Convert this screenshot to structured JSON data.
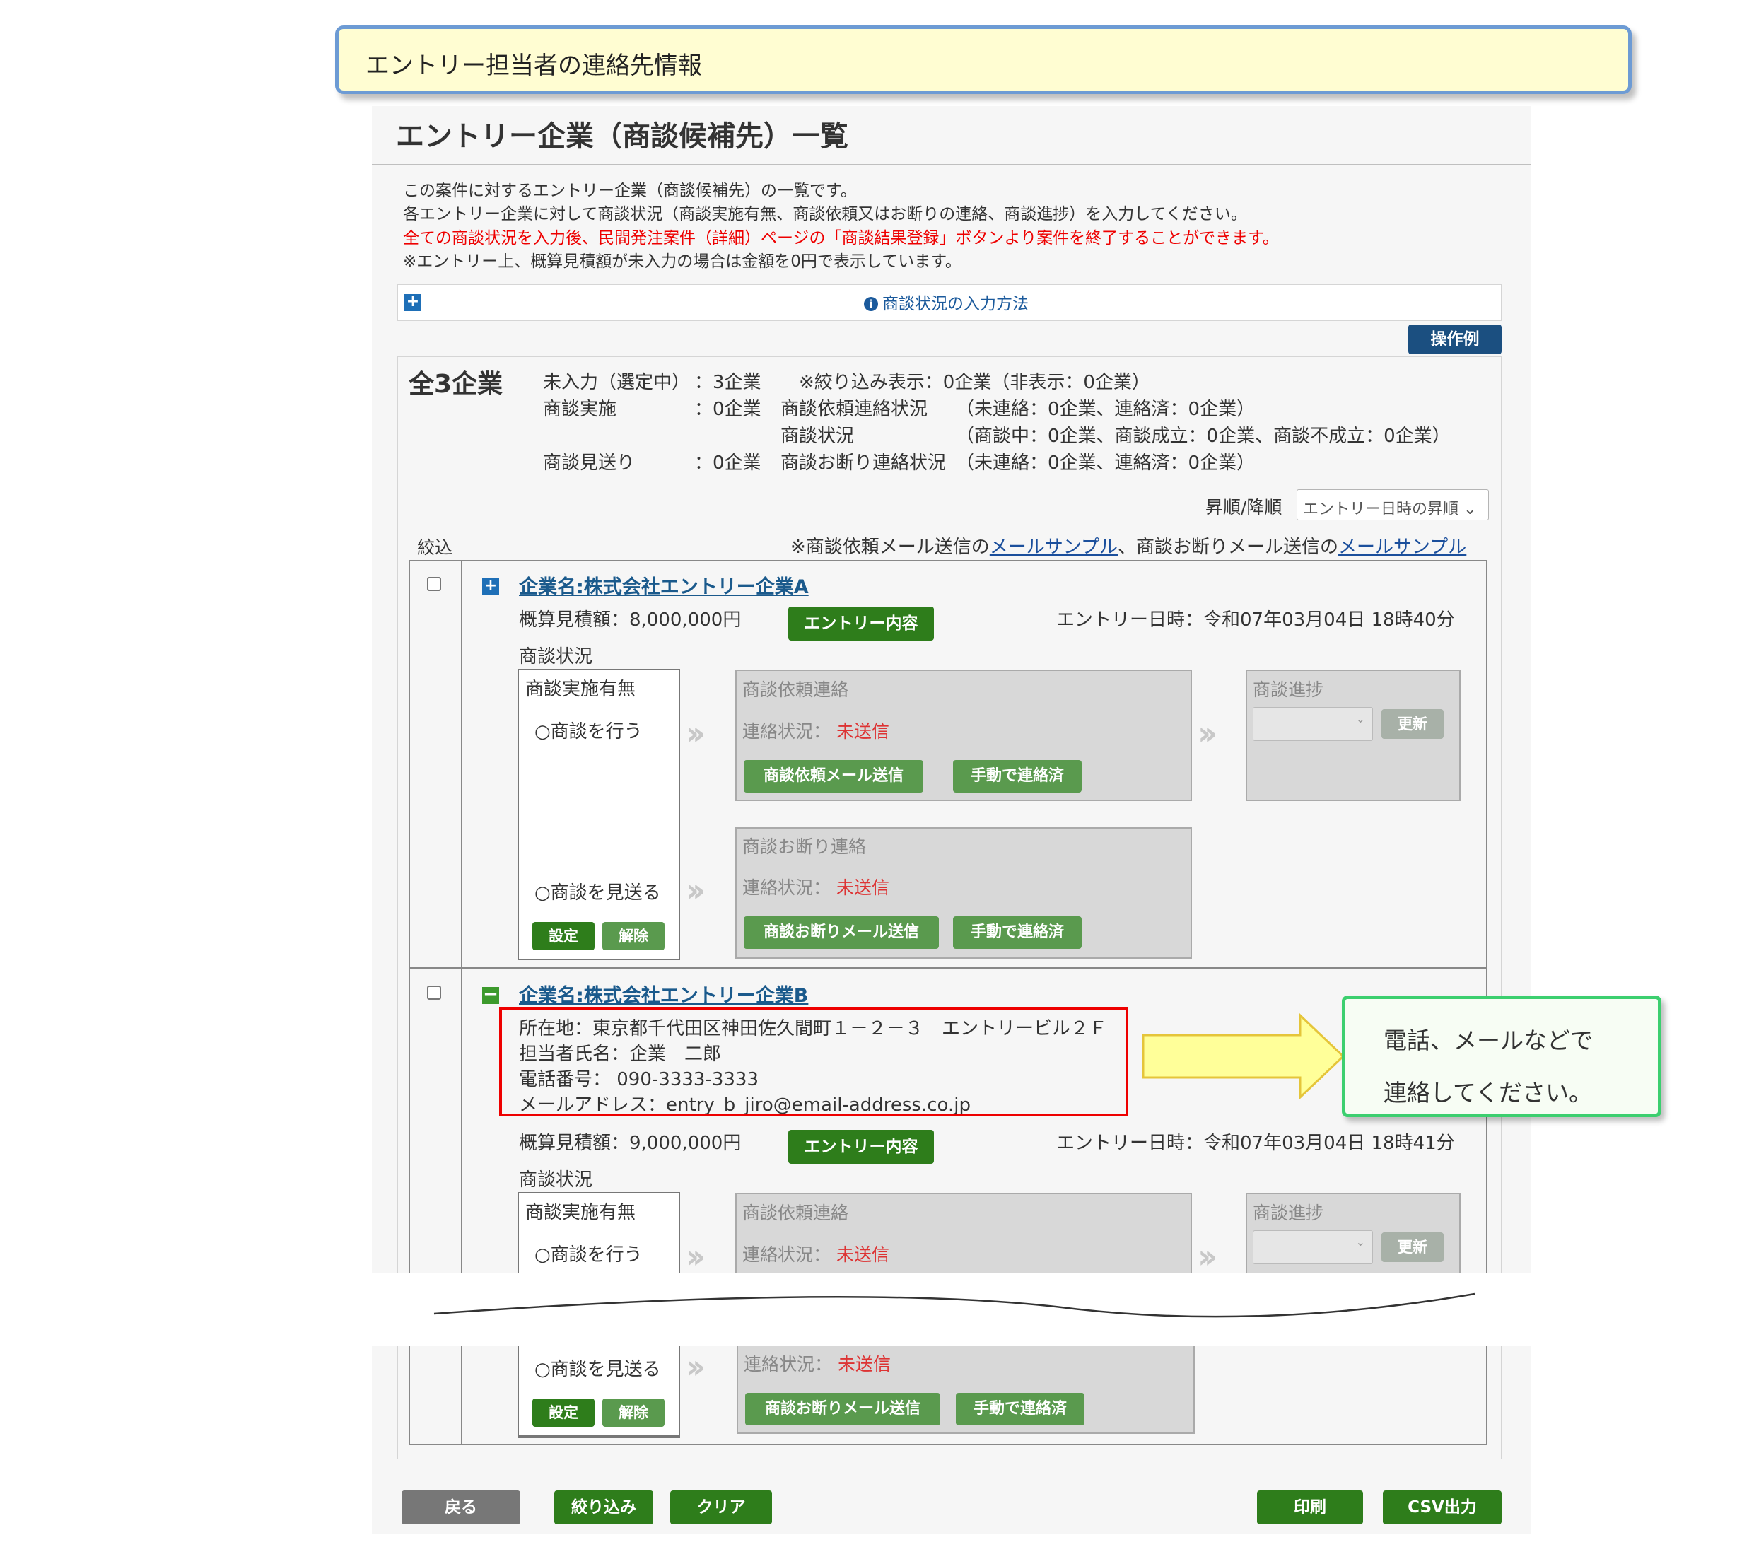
{
  "callout_top": "エントリー担当者の連絡先情報",
  "page_title": "エントリー企業（商談候補先）一覧",
  "intro": [
    "この案件に対するエントリー企業（商談候補先）の一覧です。",
    "各エントリー企業に対して商談状況（商談実施有無、商談依頼又はお断りの連絡、商談進捗）を入力してください。",
    "全ての商談状況を入力後、民間発注案件（詳細）ページの「商談結果登録」ボタンより案件を終了することができます。",
    "※エントリー上、概算見積額が未入力の場合は金額を0円で表示しています。"
  ],
  "howto_link": "商談状況の入力方法",
  "example_button": "操作例",
  "summary": {
    "total": "全3企業",
    "row1_label": "未入力（選定中）",
    "row1_value": "：3企業",
    "row1_note": "※絞り込み表示：0企業（非表示：0企業）",
    "row2_label": "商談実施",
    "row2_value": "：0企業",
    "row2_sub1_label": "商談依頼連絡状況",
    "row2_sub1_value": "（未連絡：0企業、連絡済：0企業）",
    "row2_sub2_label": "商談状況",
    "row2_sub2_value": "（商談中：0企業、商談成立：0企業、商談不成立：0企業）",
    "row3_label": "商談見送り",
    "row3_value": "：0企業",
    "row3_sub_label": "商談お断り連絡状況",
    "row3_sub_value": "（未連絡：0企業、連絡済：0企業）"
  },
  "sort": {
    "label": "昇順/降順",
    "selected": "エントリー日時の昇順"
  },
  "filter_label": "絞込",
  "mail_note": {
    "prefix": "※商談依頼メール送信の",
    "link1": "メールサンプル",
    "middle": "、商談お断りメール送信の",
    "link2": "メールサンプル"
  },
  "labels": {
    "status_section": "商談状況",
    "impl_title": "商談実施有無",
    "do_option": "○商談を行う",
    "skip_option": "○商談を見送る",
    "set_button": "設定",
    "cancel_button": "解除",
    "request_title": "商談依頼連絡",
    "decline_title": "商談お断り連絡",
    "status_prefix": "連絡状況：",
    "status_value": "未送信",
    "request_mail_button": "商談依頼メール送信",
    "decline_mail_button": "商談お断りメール送信",
    "manual_button": "手動で連絡済",
    "progress_title": "商談進捗",
    "update_button": "更新",
    "entry_content_button": "エントリー内容"
  },
  "companies": [
    {
      "name": "企業名:株式会社エントリー企業A",
      "estimate": "概算見積額：8,000,000円",
      "entry_datetime": "エントリー日時：令和07年03月04日 18時40分"
    },
    {
      "name": "企業名:株式会社エントリー企業B",
      "address": "所在地：東京都千代田区神田佐久間町１－２－３　エントリービル２Ｆ",
      "contact_name": "担当者氏名：企業　二郎",
      "phone": "電話番号： 090-3333-3333",
      "email": "メールアドレス：entry_b_jiro@email-address.co.jp",
      "estimate": "概算見積額：9,000,000円",
      "entry_datetime": "エントリー日時：令和07年03月04日 18時41分"
    }
  ],
  "callout_green": [
    "電話、メールなどで",
    "連絡してください。"
  ],
  "bottom_buttons": {
    "back": "戻る",
    "filter": "絞り込み",
    "clear": "クリア",
    "print": "印刷",
    "csv": "CSV出力"
  },
  "colors": {
    "primary_green": "#2e7d1b",
    "navy": "#1b4f80",
    "alert_red": "#ee0000",
    "callout_yellow": "#fffdd2",
    "callout_green_border": "#3ccf6f"
  }
}
